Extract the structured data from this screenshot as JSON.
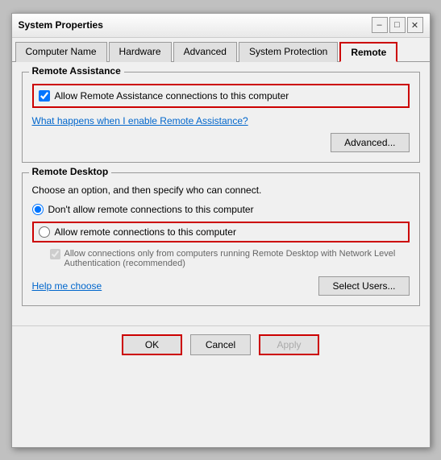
{
  "window": {
    "title": "System Properties",
    "close_label": "✕",
    "minimize_label": "–",
    "maximize_label": "□"
  },
  "tabs": [
    {
      "label": "Computer Name",
      "active": false
    },
    {
      "label": "Hardware",
      "active": false
    },
    {
      "label": "Advanced",
      "active": false
    },
    {
      "label": "System Protection",
      "active": false
    },
    {
      "label": "Remote",
      "active": true
    }
  ],
  "remote_assistance": {
    "title": "Remote Assistance",
    "checkbox_label": "Allow Remote Assistance connections to this computer",
    "checkbox_checked": true,
    "link_label": "What happens when I enable Remote Assistance?",
    "advanced_button": "Advanced..."
  },
  "remote_desktop": {
    "title": "Remote Desktop",
    "description": "Choose an option, and then specify who can connect.",
    "option1_label": "Don't allow remote connections to this computer",
    "option1_checked": true,
    "option2_label": "Allow remote connections to this computer",
    "option2_checked": false,
    "sub_option_label": "Allow connections only from computers running Remote Desktop with Network Level Authentication (recommended)",
    "help_link": "Help me choose",
    "select_users_button": "Select Users..."
  },
  "footer": {
    "ok_label": "OK",
    "cancel_label": "Cancel",
    "apply_label": "Apply"
  }
}
